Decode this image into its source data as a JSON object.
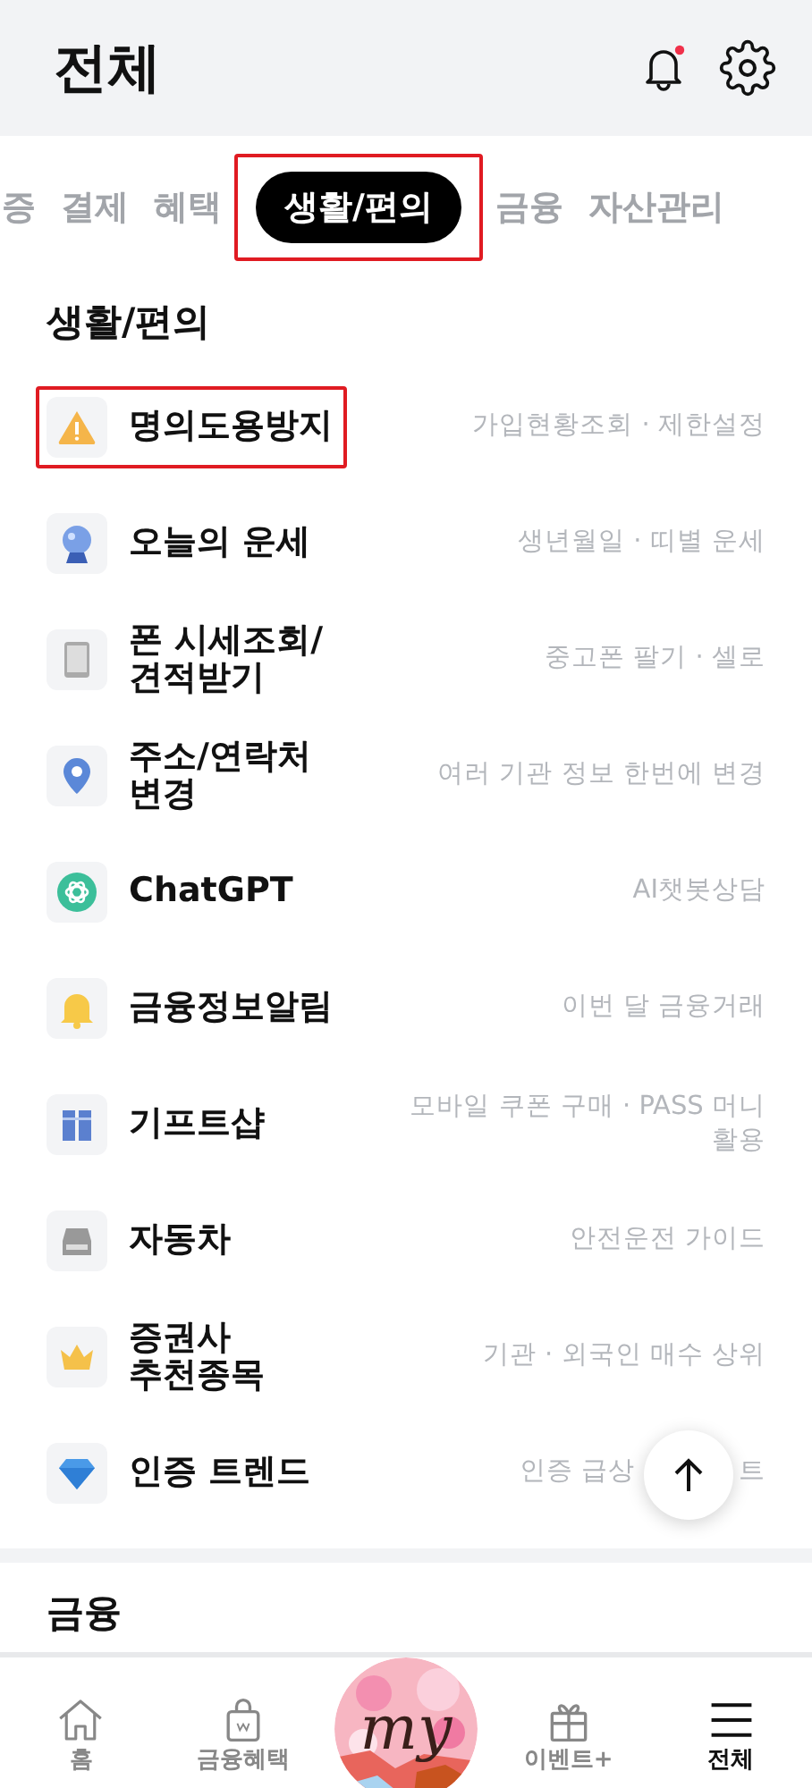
{
  "header": {
    "title": "전체",
    "notification_dot": true
  },
  "tabs": [
    {
      "label": "증",
      "selected": false,
      "highlighted": false
    },
    {
      "label": "결제",
      "selected": false,
      "highlighted": false
    },
    {
      "label": "혜택",
      "selected": false,
      "highlighted": false
    },
    {
      "label": "생활/편의",
      "selected": true,
      "highlighted": true
    },
    {
      "label": "금융",
      "selected": false,
      "highlighted": false
    },
    {
      "label": "자산관리",
      "selected": false,
      "highlighted": false
    }
  ],
  "section": {
    "title": "생활/편의",
    "items": [
      {
        "name": "명의도용방지",
        "detail": [
          "가입현황조회 · 제한설정"
        ],
        "highlighted": true
      },
      {
        "name": "오늘의 운세",
        "detail": [
          "생년월일 · 띠별 운세"
        ],
        "highlighted": false
      },
      {
        "name": "폰 시세조회/\n견적받기",
        "detail": [
          "중고폰 팔기 · 셀로"
        ],
        "highlighted": false
      },
      {
        "name": "주소/연락처\n변경",
        "detail": [
          "여러 기관 정보 한번에 변경"
        ],
        "highlighted": false
      },
      {
        "name": "ChatGPT",
        "detail": [
          "AI챗봇상담"
        ],
        "highlighted": false
      },
      {
        "name": "금융정보알림",
        "detail": [
          "이번 달 금융거래"
        ],
        "highlighted": false
      },
      {
        "name": "기프트샵",
        "detail": [
          "모바일 쿠폰 구매 · PASS 머니\n활용"
        ],
        "highlighted": false
      },
      {
        "name": "자동차",
        "detail": [
          "안전운전 가이드"
        ],
        "highlighted": false
      },
      {
        "name": "증권사\n추천종목",
        "detail": [
          "기관 · 외국인 매수 상위"
        ],
        "highlighted": false
      },
      {
        "name": "인증 트렌드",
        "detail": [
          "인증 급상",
          "트"
        ],
        "highlighted": false
      }
    ]
  },
  "next_section": {
    "title": "금융"
  },
  "bottom_nav": [
    {
      "label": "홈",
      "selected": false
    },
    {
      "label": "금융혜택",
      "selected": false
    },
    {
      "label": "my",
      "kind": "center"
    },
    {
      "label": "이벤트+",
      "selected": false
    },
    {
      "label": "전체",
      "selected": true
    }
  ]
}
